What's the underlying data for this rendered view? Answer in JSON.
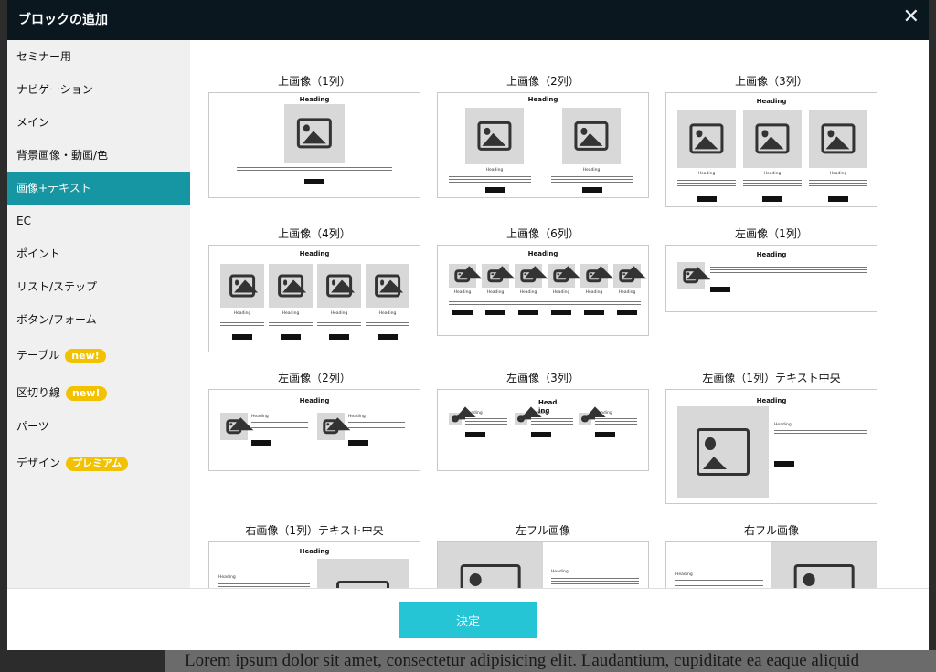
{
  "dialog": {
    "title": "ブロックの追加",
    "close_icon": "close-icon",
    "confirm_label": "決定"
  },
  "sidebar": {
    "items": [
      {
        "label": "セミナー用",
        "badge": ""
      },
      {
        "label": "ナビゲーション",
        "badge": ""
      },
      {
        "label": "メイン",
        "badge": ""
      },
      {
        "label": "背景画像・動画/色",
        "badge": ""
      },
      {
        "label": "画像+テキスト",
        "badge": "",
        "active": true
      },
      {
        "label": "EC",
        "badge": ""
      },
      {
        "label": "ポイント",
        "badge": ""
      },
      {
        "label": "リスト/ステップ",
        "badge": ""
      },
      {
        "label": "ボタン/フォーム",
        "badge": ""
      },
      {
        "label": "テーブル",
        "badge": "new!"
      },
      {
        "label": "区切り線",
        "badge": "new!"
      },
      {
        "label": "パーツ",
        "badge": ""
      },
      {
        "label": "デザイン",
        "badge": "プレミアム"
      }
    ]
  },
  "templates": [
    {
      "title": "上画像（1列）",
      "heading": "Heading"
    },
    {
      "title": "上画像（2列）",
      "heading": "Heading",
      "caption": "Heading"
    },
    {
      "title": "上画像（3列）",
      "heading": "Heading",
      "caption": "Heading"
    },
    {
      "title": "上画像（4列）",
      "heading": "Heading",
      "caption": "Heading"
    },
    {
      "title": "上画像（6列）",
      "heading": "Heading",
      "caption": "Heading"
    },
    {
      "title": "左画像（1列）",
      "heading": "Heading"
    },
    {
      "title": "左画像（2列）",
      "heading": "Heading",
      "caption": "Heading"
    },
    {
      "title": "左画像（3列）",
      "heading": "Head ing",
      "caption": "Heading"
    },
    {
      "title": "左画像（1列）テキスト中央",
      "heading": "Heading",
      "caption": "Heading"
    },
    {
      "title": "右画像（1列）テキスト中央",
      "heading": "Heading",
      "caption": "Heading"
    },
    {
      "title": "左フル画像",
      "heading": "",
      "caption": "Heading"
    },
    {
      "title": "右フル画像",
      "heading": "",
      "caption": "Heading"
    }
  ],
  "background_text": "Lorem ipsum dolor sit amet, consectetur adipisicing elit. Laudantium, cupiditate ea eaque aliquid"
}
